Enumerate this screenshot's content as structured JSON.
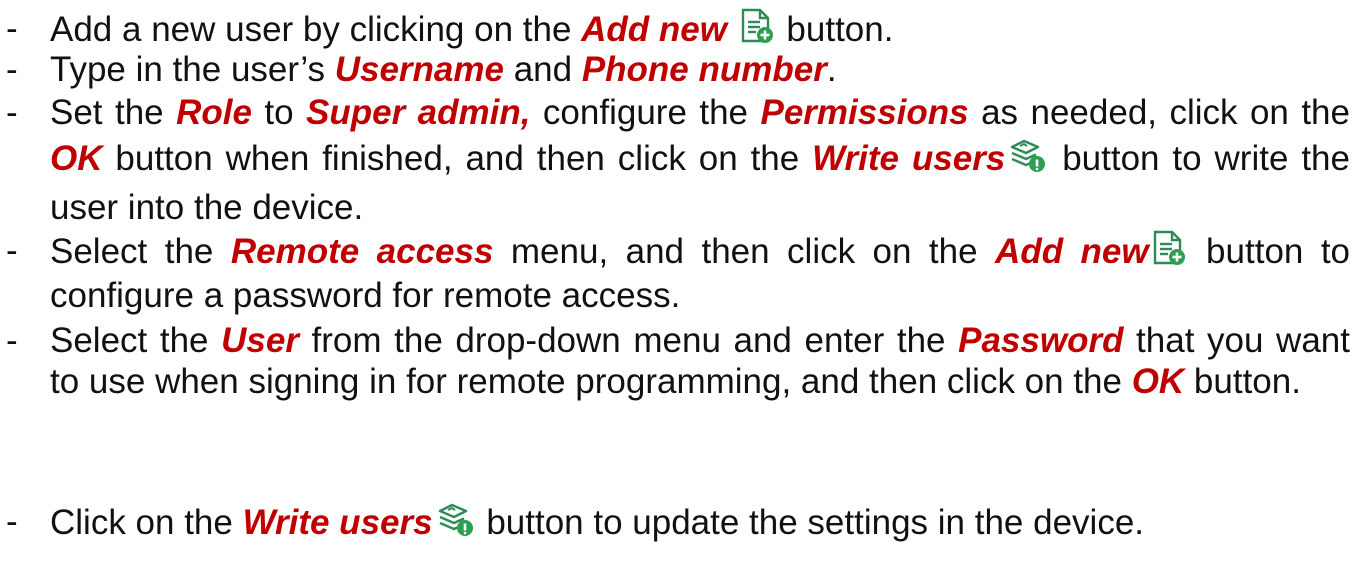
{
  "instructions": [
    {
      "dash": "-",
      "t1": "Add a new user by clicking on the ",
      "e1": "Add new",
      "icon": "add-new-icon",
      "t2": " button."
    },
    {
      "dash": "-",
      "t1": "Type in the user’s ",
      "e1": "Username",
      "t2": " and ",
      "e2": "Phone number",
      "t3": "."
    },
    {
      "dash": "-",
      "t1": "Set the ",
      "e1": "Role",
      "t2": " to ",
      "e2": "Super admin,",
      "t3": " configure the ",
      "e3": "Permissions",
      "t4": " as needed, click on the ",
      "e4": "OK",
      "t5": " button when finished, and then click on the ",
      "e5": "Write users",
      "icon": "write-users-icon",
      "t6": " button to write the user into the device."
    },
    {
      "dash": "-",
      "t1": "Select the ",
      "e1": "Remote access",
      "t2": " menu, and then click on the ",
      "e2": "Add new",
      "icon": "add-new-icon",
      "t3": " button to configure a password for remote access."
    },
    {
      "dash": "-",
      "t1": "Select the ",
      "e1": "User",
      "t2": " from the drop-down menu and enter the ",
      "e2": "Password",
      "t3": " that you want to use when signing in for remote programming, and then click on the ",
      "e3": "OK",
      "t4": " button."
    },
    {
      "dash": "-",
      "t1": "Click on the ",
      "e1": "Write users",
      "icon": "write-users-icon",
      "t2": " button to update the settings in the device."
    }
  ],
  "colors": {
    "text": "#111111",
    "emphasis": "#c00000",
    "icon_page_border": "#2e8b57",
    "icon_plus_bg": "#2e9e4f"
  }
}
